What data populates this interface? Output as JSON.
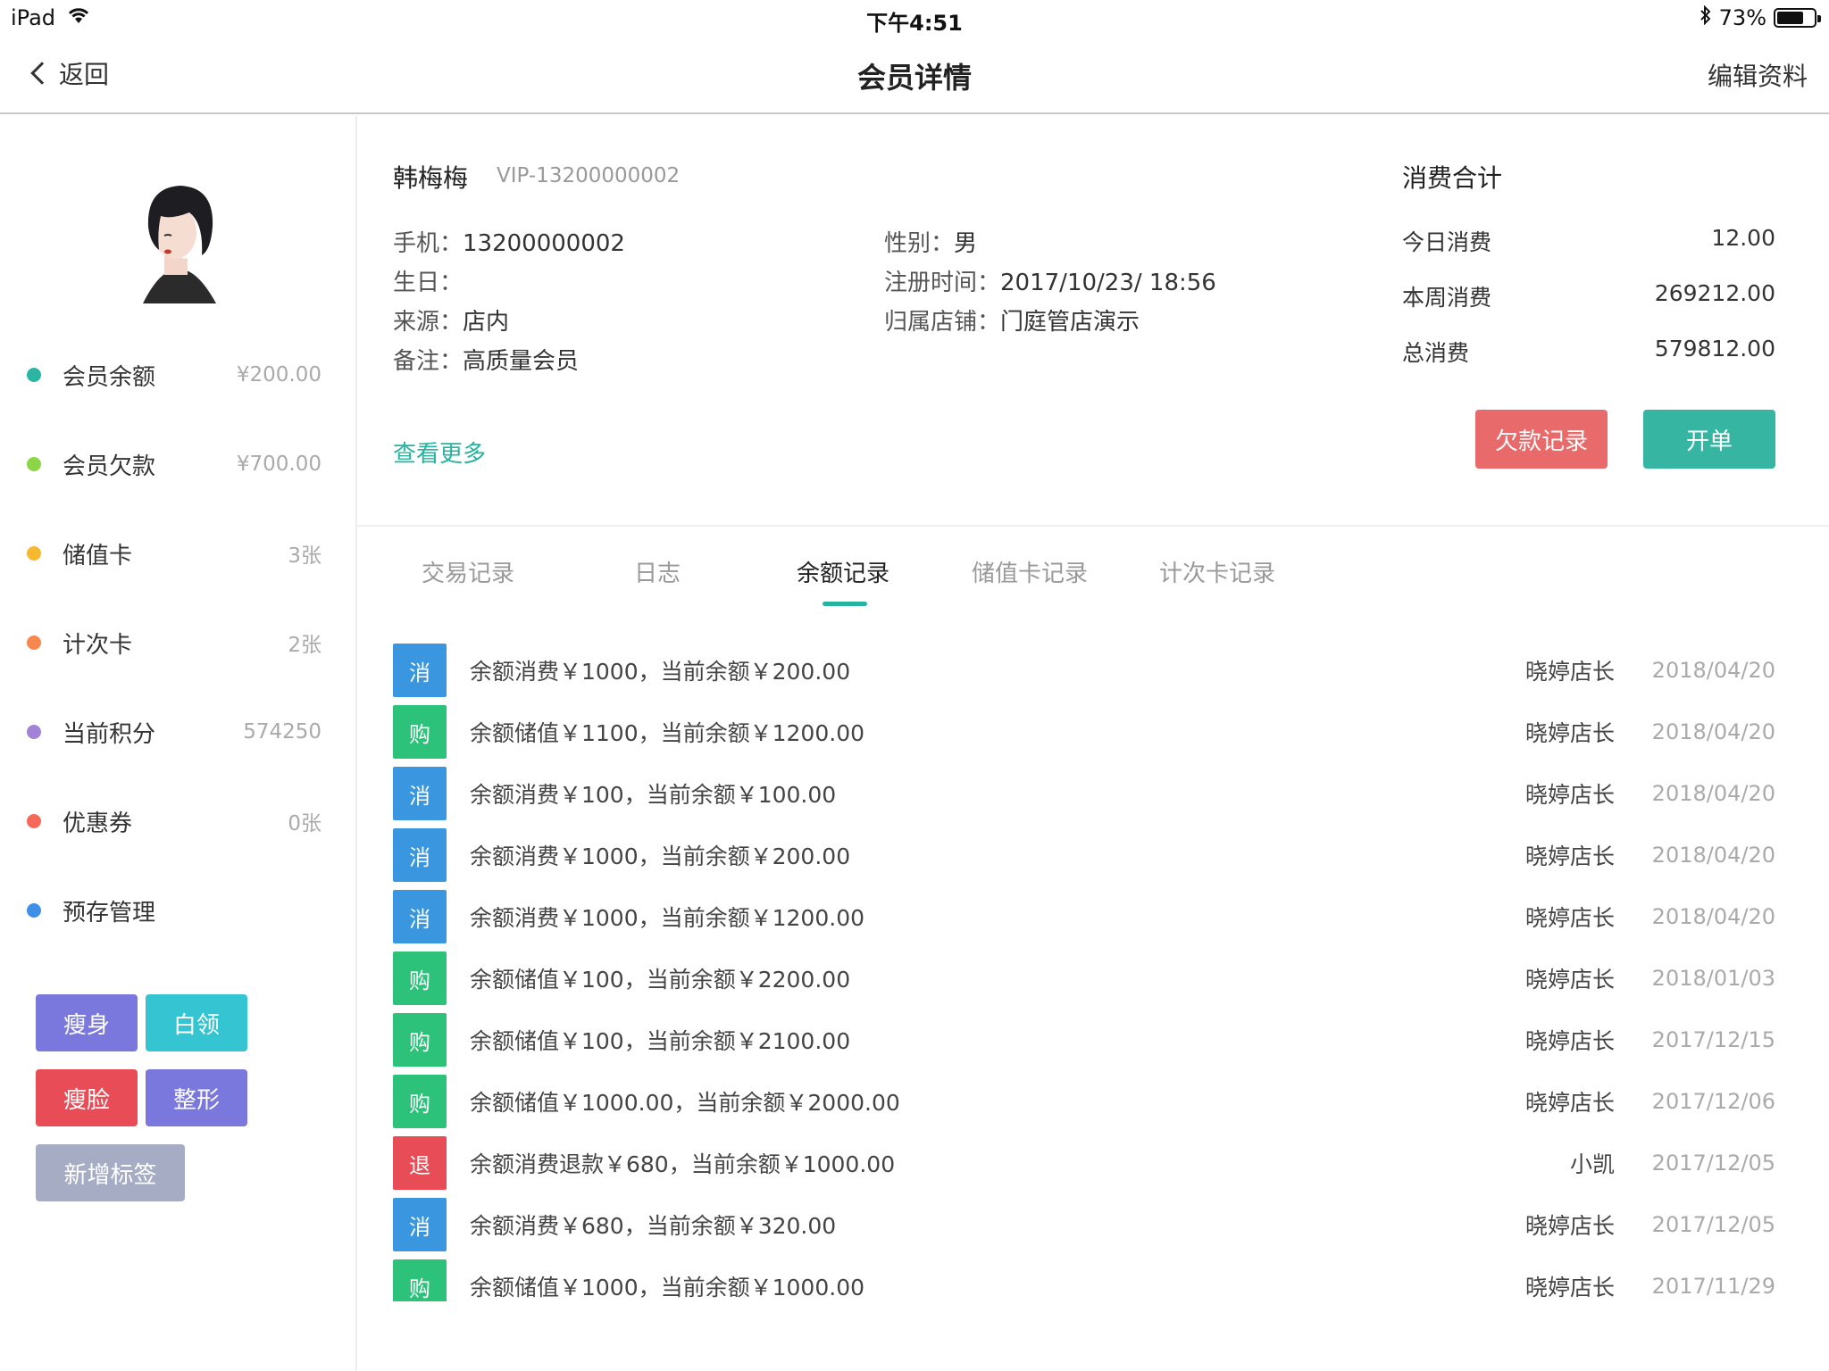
{
  "status_bar": {
    "device": "iPad",
    "time": "下午4:51",
    "battery": "73%",
    "battery_fraction": 0.73
  },
  "nav": {
    "back_label": "返回",
    "title": "会员详情",
    "edit_label": "编辑资料"
  },
  "sidebar": {
    "items": [
      {
        "label": "会员余额",
        "value": "¥200.00",
        "color": "#2db5a3"
      },
      {
        "label": "会员欠款",
        "value": "¥700.00",
        "color": "#8cd645"
      },
      {
        "label": "储值卡",
        "value": "3张",
        "color": "#f5b82e"
      },
      {
        "label": "计次卡",
        "value": "2张",
        "color": "#f7874c"
      },
      {
        "label": "当前积分",
        "value": "574250",
        "color": "#a283d8"
      },
      {
        "label": "优惠券",
        "value": "0张",
        "color": "#f76a5b"
      },
      {
        "label": "预存管理",
        "value": "",
        "color": "#3d8fe8"
      }
    ],
    "tags": [
      {
        "label": "瘦身",
        "color": "#7b78dd"
      },
      {
        "label": "白领",
        "color": "#35c4d1"
      },
      {
        "label": "瘦脸",
        "color": "#e84d57"
      },
      {
        "label": "整形",
        "color": "#7b78dd"
      },
      {
        "label": "新增标签",
        "color": "#a6acc4"
      }
    ]
  },
  "member": {
    "name": "韩梅梅",
    "vip": "VIP-13200000002",
    "phone_label": "手机：",
    "phone": "13200000002",
    "birthday_label": "生日：",
    "birthday": "",
    "source_label": "来源：",
    "source": "店内",
    "note_label": "备注：",
    "note": "高质量会员",
    "gender_label": "性别：",
    "gender": "男",
    "reg_label": "注册时间：",
    "reg_time": "2017/10/23/ 18:56",
    "store_label": "归属店铺：",
    "store": "门庭管店演示",
    "more": "查看更多"
  },
  "summary": {
    "title": "消费合计",
    "rows": [
      {
        "label": "今日消费",
        "value": "12.00"
      },
      {
        "label": "本周消费",
        "value": "269212.00"
      },
      {
        "label": "总消费",
        "value": "579812.00"
      }
    ],
    "debt_button": "欠款记录",
    "debt_color": "#e86a6a",
    "order_button": "开单",
    "order_color": "#36b5a2"
  },
  "tabs": [
    {
      "label": "交易记录",
      "active": false
    },
    {
      "label": "日志",
      "active": false
    },
    {
      "label": "余额记录",
      "active": true
    },
    {
      "label": "储值卡记录",
      "active": false
    },
    {
      "label": "计次卡记录",
      "active": false
    }
  ],
  "records": [
    {
      "type": "消",
      "color": "#3a96de",
      "desc": "余额消费￥1000，当前余额￥200.00",
      "operator": "晓婷店长",
      "date": "2018/04/20"
    },
    {
      "type": "购",
      "color": "#2dc27a",
      "desc": "余额储值￥1100，当前余额￥1200.00",
      "operator": "晓婷店长",
      "date": "2018/04/20"
    },
    {
      "type": "消",
      "color": "#3a96de",
      "desc": "余额消费￥100，当前余额￥100.00",
      "operator": "晓婷店长",
      "date": "2018/04/20"
    },
    {
      "type": "消",
      "color": "#3a96de",
      "desc": "余额消费￥1000，当前余额￥200.00",
      "operator": "晓婷店长",
      "date": "2018/04/20"
    },
    {
      "type": "消",
      "color": "#3a96de",
      "desc": "余额消费￥1000，当前余额￥1200.00",
      "operator": "晓婷店长",
      "date": "2018/04/20"
    },
    {
      "type": "购",
      "color": "#2dc27a",
      "desc": "余额储值￥100，当前余额￥2200.00",
      "operator": "晓婷店长",
      "date": "2018/01/03"
    },
    {
      "type": "购",
      "color": "#2dc27a",
      "desc": "余额储值￥100，当前余额￥2100.00",
      "operator": "晓婷店长",
      "date": "2017/12/15"
    },
    {
      "type": "购",
      "color": "#2dc27a",
      "desc": "余额储值￥1000.00，当前余额￥2000.00",
      "operator": "晓婷店长",
      "date": "2017/12/06"
    },
    {
      "type": "退",
      "color": "#e84d57",
      "desc": "余额消费退款￥680，当前余额￥1000.00",
      "operator": "小凯",
      "date": "2017/12/05"
    },
    {
      "type": "消",
      "color": "#3a96de",
      "desc": "余额消费￥680，当前余额￥320.00",
      "operator": "晓婷店长",
      "date": "2017/12/05"
    },
    {
      "type": "购",
      "color": "#2dc27a",
      "desc": "余额储值￥1000，当前余额￥1000.00",
      "operator": "晓婷店长",
      "date": "2017/11/29"
    }
  ]
}
